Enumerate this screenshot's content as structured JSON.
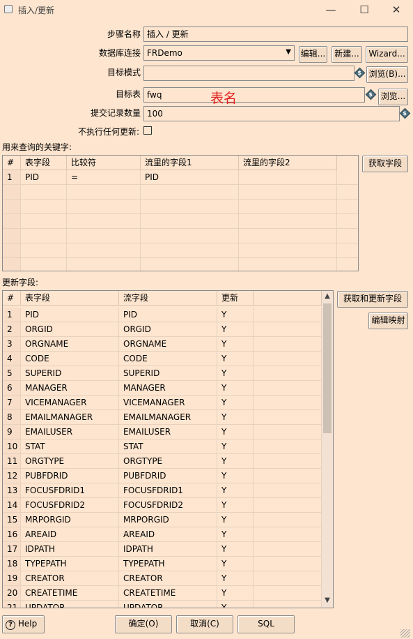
{
  "window": {
    "title": "插入/更新",
    "minimize": "—",
    "maximize": "☐",
    "close": "✕"
  },
  "form": {
    "step_name_label": "步骤名称",
    "step_name_value": "插入 / 更新",
    "db_conn_label": "数据库连接",
    "db_conn_value": "FRDemo",
    "edit_btn": "编辑...",
    "new_btn": "新建...",
    "wizard_btn": "Wizard...",
    "target_schema_label": "目标模式",
    "target_schema_value": "",
    "browse_schema_btn": "浏览(B)...",
    "target_table_label": "目标表",
    "target_table_value": "fwq",
    "table_note": "表名",
    "browse_table_btn": "浏览...",
    "commit_label": "提交记录数量",
    "commit_value": "100",
    "no_update_label": "不执行任何更新:",
    "variable_icon": "$"
  },
  "keys": {
    "section_label": "用来查询的关键字:",
    "get_fields_btn": "获取字段",
    "columns": [
      "#",
      "表字段",
      "比较符",
      "流里的字段1",
      "流里的字段2"
    ],
    "rows": [
      [
        "1",
        "PID",
        "=",
        "PID",
        ""
      ]
    ]
  },
  "update": {
    "section_label": "更新字段:",
    "get_update_btn": "获取和更新字段",
    "edit_mapping_btn": "编辑映射",
    "columns": [
      "#",
      "表字段",
      "流字段",
      "更新"
    ],
    "rows": [
      [
        "1",
        "PID",
        "PID",
        "Y"
      ],
      [
        "2",
        "ORGID",
        "ORGID",
        "Y"
      ],
      [
        "3",
        "ORGNAME",
        "ORGNAME",
        "Y"
      ],
      [
        "4",
        "CODE",
        "CODE",
        "Y"
      ],
      [
        "5",
        "SUPERID",
        "SUPERID",
        "Y"
      ],
      [
        "6",
        "MANAGER",
        "MANAGER",
        "Y"
      ],
      [
        "7",
        "VICEMANAGER",
        "VICEMANAGER",
        "Y"
      ],
      [
        "8",
        "EMAILMANAGER",
        "EMAILMANAGER",
        "Y"
      ],
      [
        "9",
        "EMAILUSER",
        "EMAILUSER",
        "Y"
      ],
      [
        "10",
        "STAT",
        "STAT",
        "Y"
      ],
      [
        "11",
        "ORGTYPE",
        "ORGTYPE",
        "Y"
      ],
      [
        "12",
        "PUBFDRID",
        "PUBFDRID",
        "Y"
      ],
      [
        "13",
        "FOCUSFDRID1",
        "FOCUSFDRID1",
        "Y"
      ],
      [
        "14",
        "FOCUSFDRID2",
        "FOCUSFDRID2",
        "Y"
      ],
      [
        "15",
        "MRPORGID",
        "MRPORGID",
        "Y"
      ],
      [
        "16",
        "AREAID",
        "AREAID",
        "Y"
      ],
      [
        "17",
        "IDPATH",
        "IDPATH",
        "Y"
      ],
      [
        "18",
        "TYPEPATH",
        "TYPEPATH",
        "Y"
      ],
      [
        "19",
        "CREATOR",
        "CREATOR",
        "Y"
      ],
      [
        "20",
        "CREATETIME",
        "CREATETIME",
        "Y"
      ],
      [
        "21",
        "UPDATOR",
        "UPDATOR",
        "Y"
      ]
    ]
  },
  "footer": {
    "help_btn": "Help",
    "ok_btn": "确定(O)",
    "cancel_btn": "取消(C)",
    "sql_btn": "SQL"
  }
}
